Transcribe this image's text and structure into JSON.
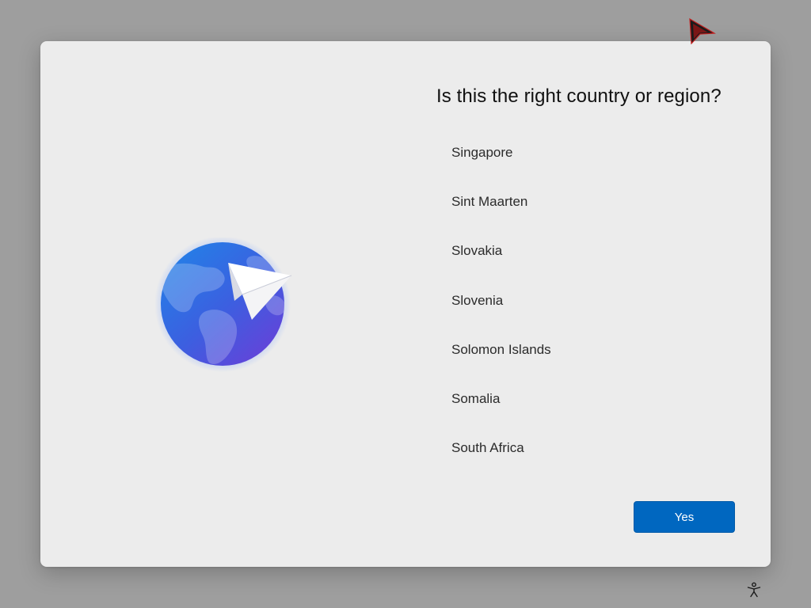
{
  "dialog": {
    "title": "Is this the right country or region?",
    "countries": [
      {
        "label": "Singapore"
      },
      {
        "label": "Sint Maarten"
      },
      {
        "label": "Slovakia"
      },
      {
        "label": "Slovenia"
      },
      {
        "label": "Solomon Islands"
      },
      {
        "label": "Somalia"
      },
      {
        "label": "South Africa"
      }
    ],
    "yes_button_label": "Yes"
  },
  "icons": {
    "illustration": "globe-paper-plane-icon",
    "accessibility": "accessibility-icon",
    "cursor": "mouse-pointer-icon"
  },
  "colors": {
    "accent": "#0067c0",
    "dialog_background": "#ececec",
    "screen_background": "#9e9e9e"
  }
}
